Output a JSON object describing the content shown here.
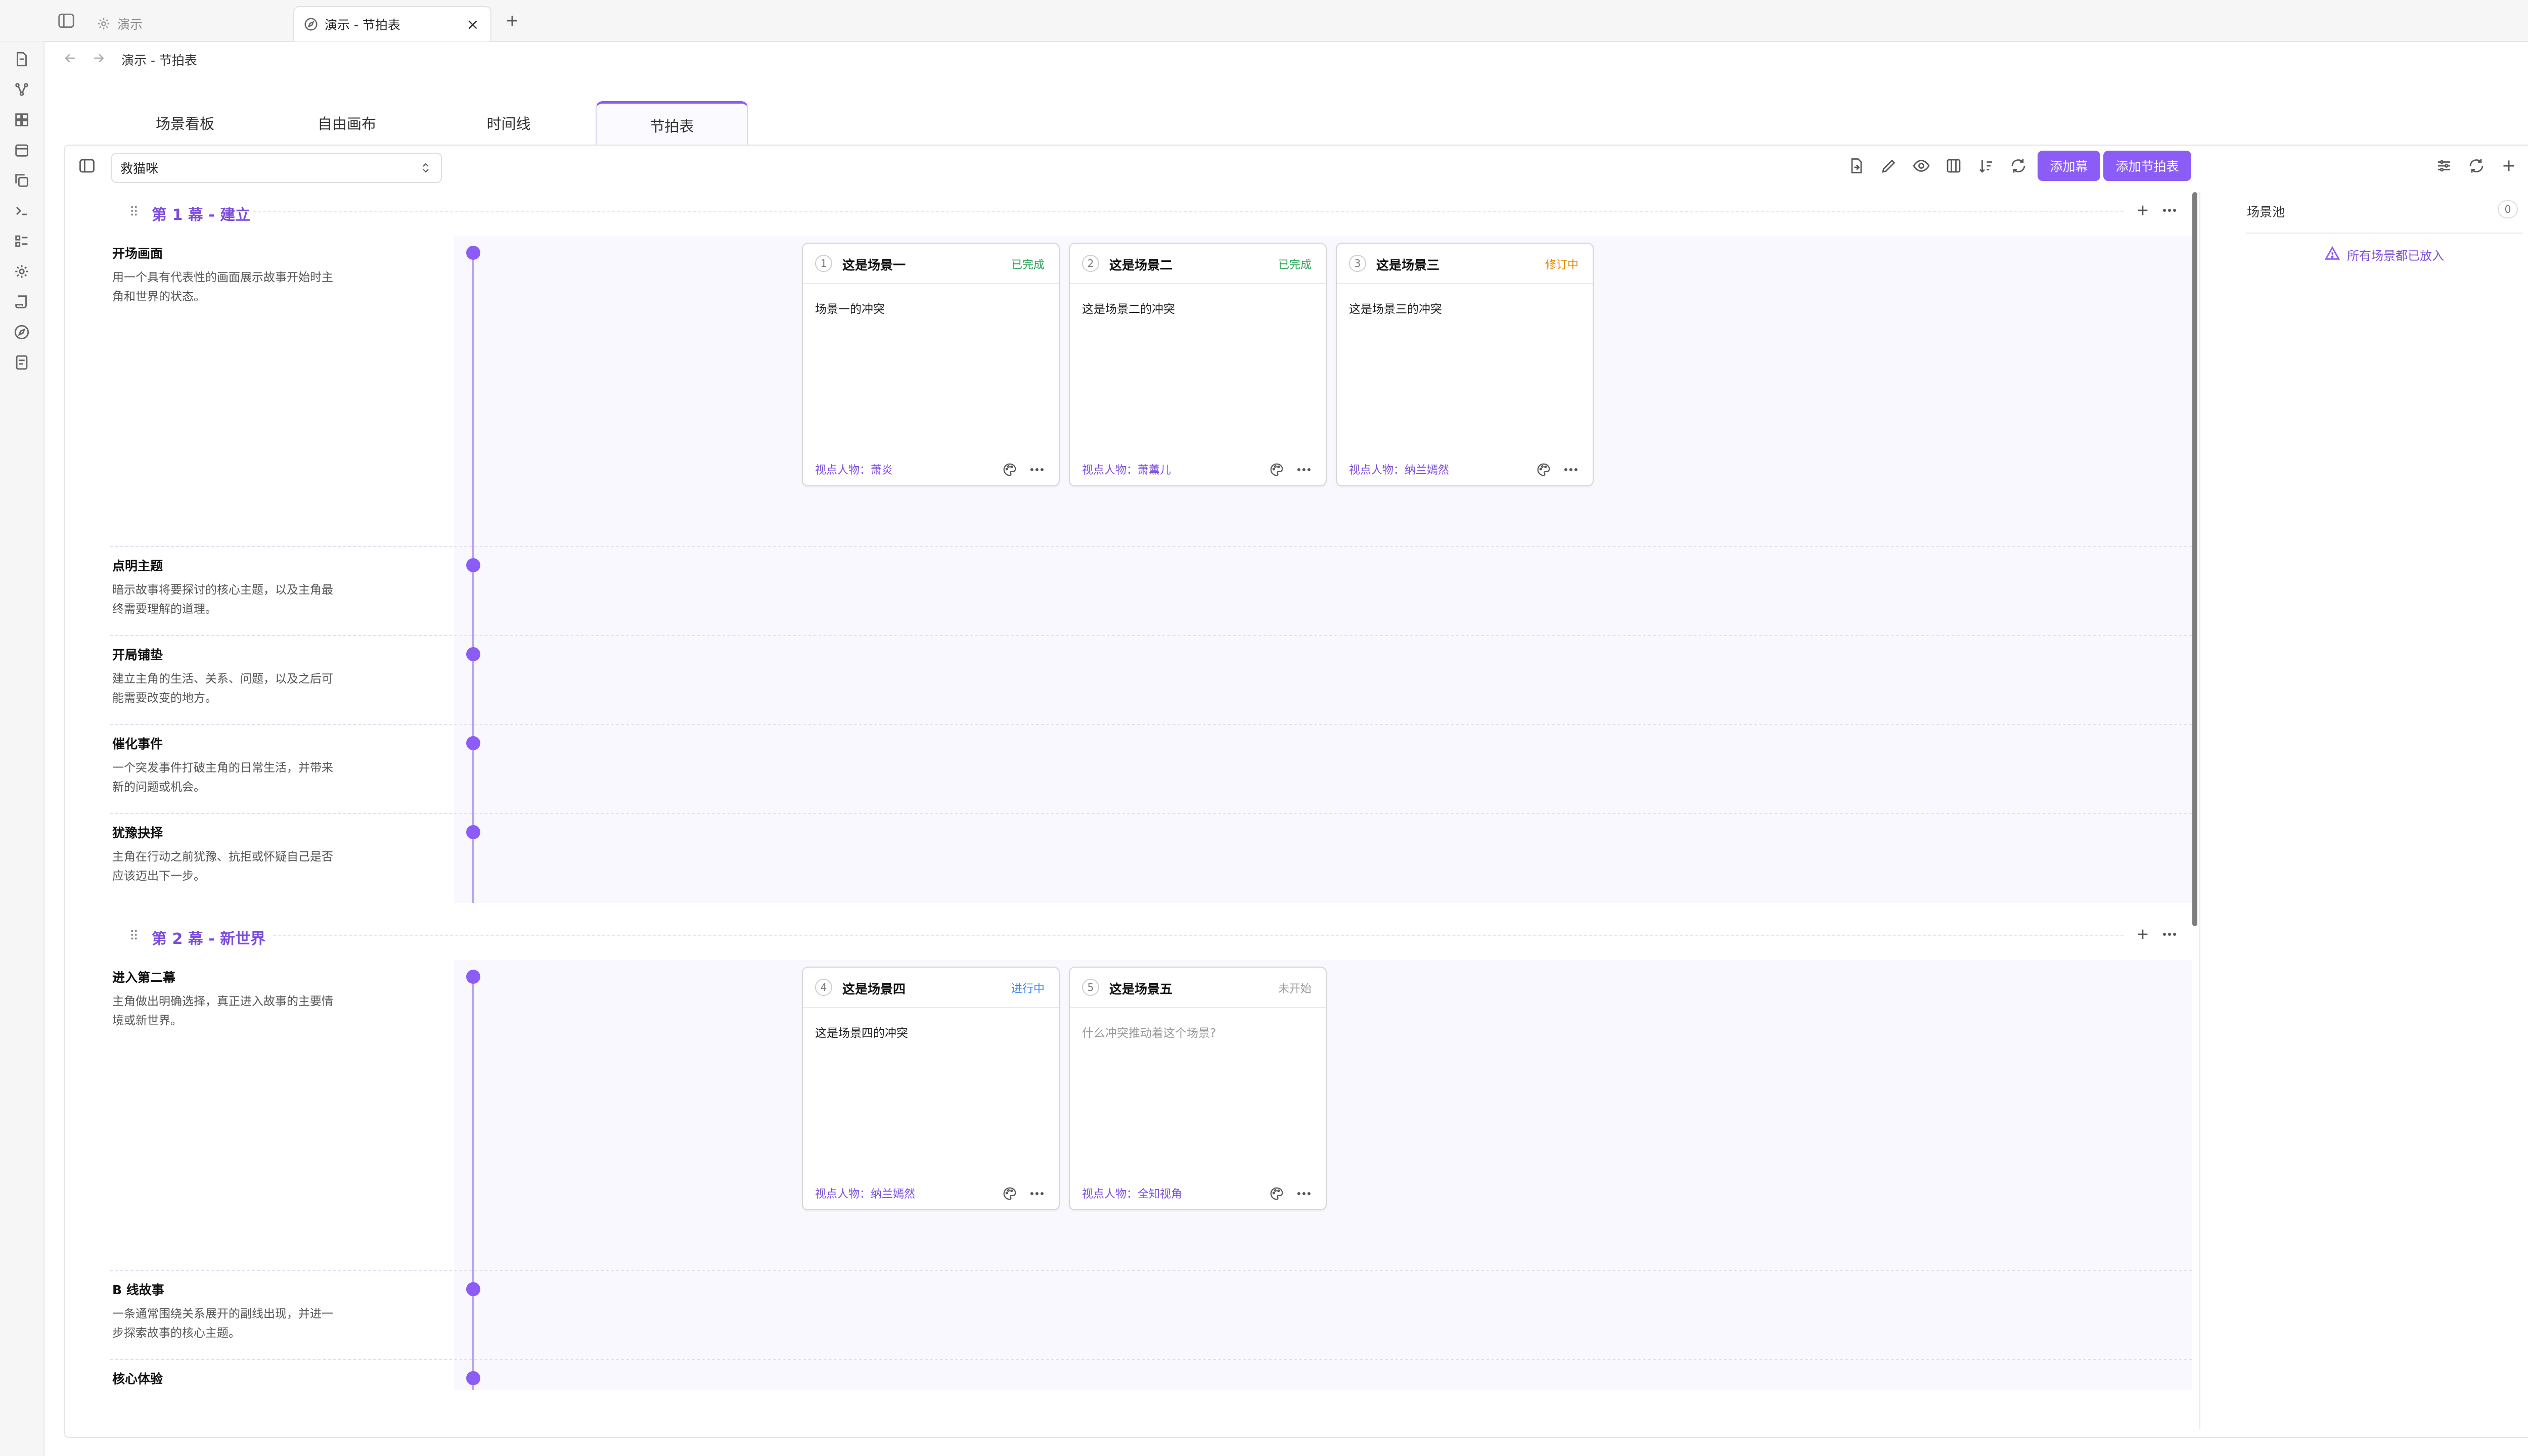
{
  "window": {
    "tabs": [
      {
        "label": "演示",
        "active": false
      },
      {
        "label": "演示 - 节拍表",
        "active": true
      }
    ]
  },
  "nav": {
    "breadcrumb": "演示 - 节拍表"
  },
  "view_tabs": [
    {
      "label": "场景看板"
    },
    {
      "label": "自由画布"
    },
    {
      "label": "时间线"
    },
    {
      "label": "节拍表",
      "active": true
    }
  ],
  "toolbar": {
    "template_value": "救猫咪",
    "add_act_label": "添加幕",
    "add_sheet_label": "添加节拍表"
  },
  "colors": {
    "accent": "#8b5cf6",
    "done": "#22a350",
    "revising": "#e08a00",
    "in_progress": "#3b82f6",
    "not_started": "#9a9a9a"
  },
  "acts": [
    {
      "title": "第 1 幕 - 建立",
      "beats": [
        {
          "name": "开场画面",
          "desc1": "用一个具有代表性的画面展示故事开始时主",
          "desc2": "角和世界的状态。"
        },
        {
          "name": "点明主题",
          "desc1": "暗示故事将要探讨的核心主题，以及主角最",
          "desc2": "终需要理解的道理。"
        },
        {
          "name": "开局铺垫",
          "desc1": "建立主角的生活、关系、问题，以及之后可",
          "desc2": "能需要改变的地方。"
        },
        {
          "name": "催化事件",
          "desc1": "一个突发事件打破主角的日常生活，并带来",
          "desc2": "新的问题或机会。"
        },
        {
          "name": "犹豫抉择",
          "desc1": "主角在行动之前犹豫、抗拒或怀疑自己是否",
          "desc2": "应该迈出下一步。"
        }
      ]
    },
    {
      "title": "第 2 幕 - 新世界",
      "beats": [
        {
          "name": "进入第二幕",
          "desc1": "主角做出明确选择，真正进入故事的主要情",
          "desc2": "境或新世界。"
        },
        {
          "name": "B 线故事",
          "desc1": "一条通常围绕关系展开的副线出现，并进一",
          "desc2": "步探索故事的核心主题。"
        },
        {
          "name": "核心体验",
          "desc1": "",
          "desc2": ""
        }
      ]
    }
  ],
  "cards": [
    {
      "num": "1",
      "title": "这是场景一",
      "status": "已完成",
      "conflict": "场景一的冲突",
      "pov": "视点人物：萧炎"
    },
    {
      "num": "2",
      "title": "这是场景二",
      "status": "已完成",
      "conflict": "这是场景二的冲突",
      "pov": "视点人物：萧薰儿"
    },
    {
      "num": "3",
      "title": "这是场景三",
      "status": "修订中",
      "conflict": "这是场景三的冲突",
      "pov": "视点人物：纳兰嫣然"
    },
    {
      "num": "4",
      "title": "这是场景四",
      "status": "进行中",
      "conflict": "这是场景四的冲突",
      "pov": "视点人物：纳兰嫣然"
    },
    {
      "num": "5",
      "title": "这是场景五",
      "status": "未开始",
      "conflict": "",
      "conflict_placeholder": "什么冲突推动着这个场景?",
      "pov": "视点人物：全知视角"
    }
  ],
  "scene_pool": {
    "title": "场景池",
    "count": "0",
    "empty_text": "所有场景都已放入"
  }
}
